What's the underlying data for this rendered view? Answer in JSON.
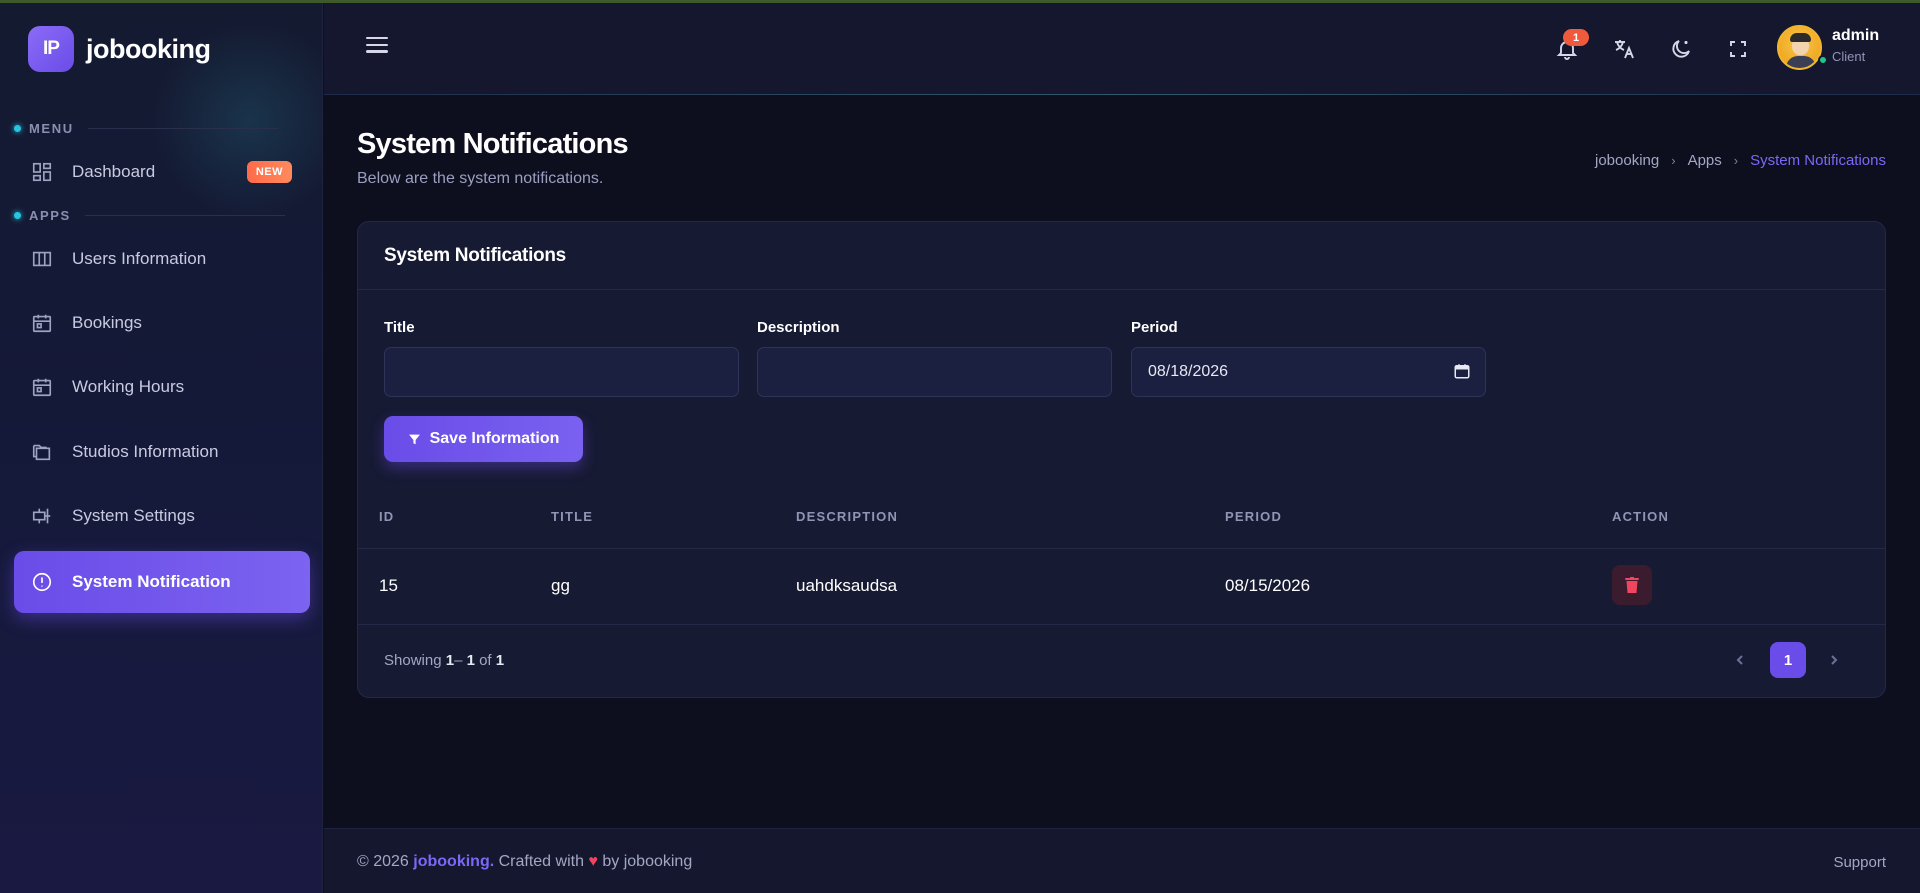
{
  "app": {
    "brand_initials": "IP",
    "brand_name": "jobooking"
  },
  "sidebar": {
    "menu_label": "MENU",
    "apps_label": "APPS",
    "dashboard": {
      "label": "Dashboard",
      "badge": "NEW"
    },
    "items": [
      {
        "label": "Users Information",
        "icon": "table-columns-icon"
      },
      {
        "label": "Bookings",
        "icon": "calendar-icon"
      },
      {
        "label": "Working Hours",
        "icon": "calendar-icon"
      },
      {
        "label": "Studios Information",
        "icon": "folders-icon"
      },
      {
        "label": "System Settings",
        "icon": "settings-icon"
      },
      {
        "label": "System Notification",
        "icon": "alert-circle-icon",
        "active": true
      }
    ]
  },
  "header": {
    "notification_count": "1",
    "user": {
      "name": "admin",
      "role": "Client"
    }
  },
  "page": {
    "title": "System Notifications",
    "subtitle": "Below are the system notifications.",
    "breadcrumb": [
      "jobooking",
      "Apps",
      "System Notifications"
    ]
  },
  "card": {
    "title": "System Notifications",
    "form": {
      "title_label": "Title",
      "title_value": "",
      "description_label": "Description",
      "description_value": "",
      "period_label": "Period",
      "period_value": "08/18/2026",
      "save_label": "Save Information"
    },
    "table": {
      "columns": [
        "ID",
        "TITLE",
        "DESCRIPTION",
        "PERIOD",
        "ACTION"
      ],
      "rows": [
        {
          "id": "15",
          "title": "gg",
          "description": "uahdksaudsa",
          "period": "08/15/2026"
        }
      ]
    },
    "pagination": {
      "showing_prefix": "Showing ",
      "range_start": "1",
      "range_sep": "– ",
      "range_end": "1",
      "of_text": " of ",
      "total": "1",
      "current_page": "1"
    }
  },
  "footer": {
    "copyright": "© 2026 ",
    "brand": "jobooking.",
    "crafted": " Crafted with ",
    "heart": "♥",
    "by": " by jobooking",
    "support": "Support"
  },
  "colors": {
    "accent": "#6a4ce8",
    "sidebar_bg": "#15193a",
    "body_bg": "#0d0f1f",
    "danger": "#f0455e",
    "badge_new": "#ff6b4a"
  }
}
